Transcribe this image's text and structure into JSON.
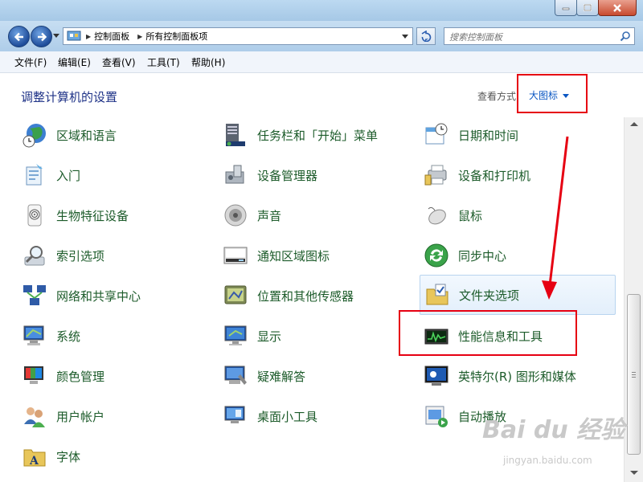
{
  "window": {
    "minimize_label": "minimize",
    "maximize_label": "maximize",
    "close_label": "close"
  },
  "address": {
    "segments": [
      "控制面板",
      "所有控制面板项"
    ]
  },
  "search": {
    "placeholder": "搜索控制面板"
  },
  "menu": {
    "file": "文件(F)",
    "edit": "编辑(E)",
    "view": "查看(V)",
    "tools": "工具(T)",
    "help": "帮助(H)"
  },
  "header": {
    "title": "调整计算机的设置",
    "view_by_label": "查看方式",
    "view_by_value": "大图标"
  },
  "items": {
    "region": "区域和语言",
    "taskbar": "任务栏和「开始」菜单",
    "datetime": "日期和时间",
    "getting_started": "入门",
    "device_manager": "设备管理器",
    "devices_printers": "设备和打印机",
    "biometric": "生物特征设备",
    "sound": "声音",
    "mouse": "鼠标",
    "indexing": "索引选项",
    "notification": "通知区域图标",
    "sync": "同步中心",
    "network": "网络和共享中心",
    "location": "位置和其他传感器",
    "folder_options": "文件夹选项",
    "system": "系统",
    "display": "显示",
    "performance": "性能信息和工具",
    "color": "颜色管理",
    "troubleshooting": "疑难解答",
    "intel": "英特尔(R) 图形和媒体",
    "user_accounts": "用户帐户",
    "gadgets": "桌面小工具",
    "autoplay": "自动播放",
    "fonts": "字体"
  },
  "watermark": {
    "logo": "Bai du 经验",
    "url": "jingyan.baidu.com"
  },
  "colors": {
    "accent_red": "#e60012",
    "link_blue": "#0b57c3",
    "item_green": "#1c5b2a",
    "title_blue": "#1e3287"
  }
}
